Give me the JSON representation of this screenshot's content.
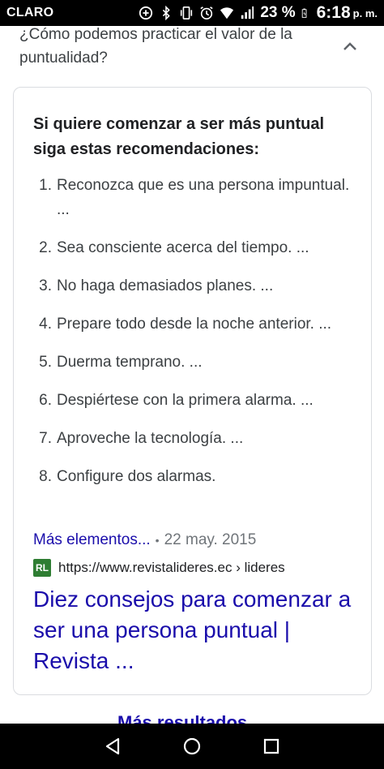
{
  "status_bar": {
    "carrier": "CLARO",
    "battery": "23 %",
    "time": "6:18",
    "ampm": "p. m."
  },
  "question": {
    "text": "¿Cómo podemos practicar el valor de la puntualidad?"
  },
  "answer": {
    "heading": "Si quiere comenzar a ser más puntual siga estas recomendaciones:",
    "steps": [
      {
        "num": "1.",
        "text": "Reconozca que es una persona impuntual. ..."
      },
      {
        "num": "2.",
        "text": "Sea consciente acerca del tiempo. ..."
      },
      {
        "num": "3.",
        "text": "No haga demasiados planes. ..."
      },
      {
        "num": "4.",
        "text": "Prepare todo desde la noche anterior. ..."
      },
      {
        "num": "5.",
        "text": "Duerma temprano. ..."
      },
      {
        "num": "6.",
        "text": "Despiértese con la primera alarma. ..."
      },
      {
        "num": "7.",
        "text": "Aproveche la tecnología. ..."
      },
      {
        "num": "8.",
        "text": "Configure dos alarmas."
      }
    ],
    "more_link": "Más elementos...",
    "date": "22 may. 2015",
    "favicon_text": "RL",
    "source_url": "https://www.revistalideres.ec › lideres",
    "result_title": "Diez consejos para comenzar a ser una persona puntual | Revista ..."
  },
  "more_results_peek": "Más resultados",
  "colors": {
    "link": "#1a0dab",
    "favicon": "#2e7d32"
  }
}
